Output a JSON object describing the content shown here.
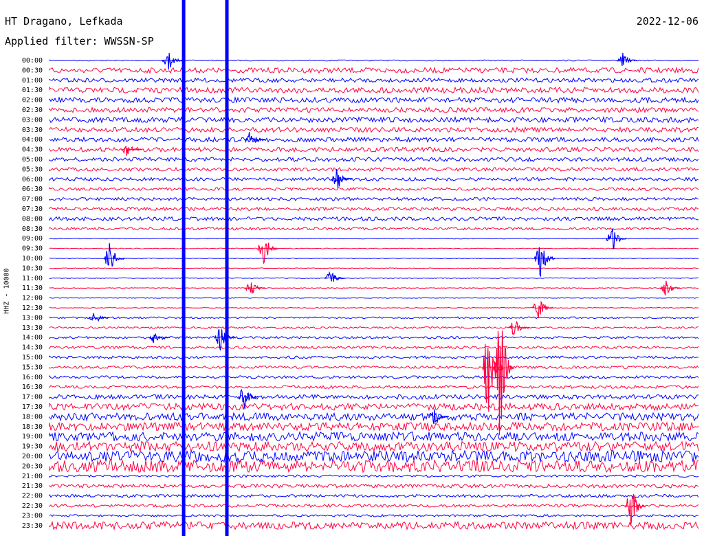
{
  "header": {
    "station": "HT Dragano, Lefkada",
    "filter": "Applied filter: WWSSN-SP",
    "date": "2022-12-06"
  },
  "y_axis_label": "HHZ - 10000",
  "chart_data": {
    "type": "line",
    "title": "HT Dragano, Lefkada",
    "subtitle": "Applied filter: WWSSN-SP",
    "date": "2022-12-06",
    "ylabel": "HHZ - 10000",
    "x_range_minutes": [
      0,
      30
    ],
    "trace_colors": [
      "#0000ff",
      "#ff0040"
    ],
    "rows": [
      {
        "label": "00:00",
        "amplitude": 0.15
      },
      {
        "label": "00:30",
        "amplitude": 0.7
      },
      {
        "label": "01:00",
        "amplitude": 0.55
      },
      {
        "label": "01:30",
        "amplitude": 0.75
      },
      {
        "label": "02:00",
        "amplitude": 0.7
      },
      {
        "label": "02:30",
        "amplitude": 0.65
      },
      {
        "label": "03:00",
        "amplitude": 0.7
      },
      {
        "label": "03:30",
        "amplitude": 0.65
      },
      {
        "label": "04:00",
        "amplitude": 0.6
      },
      {
        "label": "04:30",
        "amplitude": 0.6
      },
      {
        "label": "05:00",
        "amplitude": 0.55
      },
      {
        "label": "05:30",
        "amplitude": 0.5
      },
      {
        "label": "06:00",
        "amplitude": 0.45
      },
      {
        "label": "06:30",
        "amplitude": 0.4
      },
      {
        "label": "07:00",
        "amplitude": 0.4
      },
      {
        "label": "07:30",
        "amplitude": 0.45
      },
      {
        "label": "08:00",
        "amplitude": 0.5
      },
      {
        "label": "08:30",
        "amplitude": 0.35
      },
      {
        "label": "09:00",
        "amplitude": 0.1
      },
      {
        "label": "09:30",
        "amplitude": 0.1
      },
      {
        "label": "10:00",
        "amplitude": 0.1
      },
      {
        "label": "10:30",
        "amplitude": 0.1
      },
      {
        "label": "11:00",
        "amplitude": 0.1
      },
      {
        "label": "11:30",
        "amplitude": 0.1
      },
      {
        "label": "12:00",
        "amplitude": 0.1
      },
      {
        "label": "12:30",
        "amplitude": 0.1
      },
      {
        "label": "13:00",
        "amplitude": 0.25
      },
      {
        "label": "13:30",
        "amplitude": 0.25
      },
      {
        "label": "14:00",
        "amplitude": 0.3
      },
      {
        "label": "14:30",
        "amplitude": 0.35
      },
      {
        "label": "15:00",
        "amplitude": 0.35
      },
      {
        "label": "15:30",
        "amplitude": 0.35
      },
      {
        "label": "16:00",
        "amplitude": 0.35
      },
      {
        "label": "16:30",
        "amplitude": 0.4
      },
      {
        "label": "17:00",
        "amplitude": 0.6
      },
      {
        "label": "17:30",
        "amplitude": 0.9
      },
      {
        "label": "18:00",
        "amplitude": 1.0
      },
      {
        "label": "18:30",
        "amplitude": 1.1
      },
      {
        "label": "19:00",
        "amplitude": 1.2
      },
      {
        "label": "19:30",
        "amplitude": 1.3
      },
      {
        "label": "20:00",
        "amplitude": 1.5
      },
      {
        "label": "20:30",
        "amplitude": 1.6
      },
      {
        "label": "21:00",
        "amplitude": 0.3
      },
      {
        "label": "21:30",
        "amplitude": 0.5
      },
      {
        "label": "22:00",
        "amplitude": 0.4
      },
      {
        "label": "22:30",
        "amplitude": 0.4
      },
      {
        "label": "23:00",
        "amplitude": 0.3
      },
      {
        "label": "23:30",
        "amplitude": 1.0
      }
    ],
    "events": [
      {
        "row": "00:00",
        "minute": 5.5,
        "peak": 1.2
      },
      {
        "row": "00:00",
        "minute": 26.5,
        "peak": 0.8
      },
      {
        "row": "04:00",
        "minute": 9.3,
        "peak": 1.0
      },
      {
        "row": "04:30",
        "minute": 3.6,
        "peak": 0.8
      },
      {
        "row": "06:00",
        "minute": 13.3,
        "peak": 1.2
      },
      {
        "row": "09:00",
        "minute": 26.0,
        "peak": 1.5
      },
      {
        "row": "09:30",
        "minute": 9.9,
        "peak": 1.8
      },
      {
        "row": "10:00",
        "minute": 2.8,
        "peak": 2.0
      },
      {
        "row": "10:00",
        "minute": 22.7,
        "peak": 2.2
      },
      {
        "row": "11:00",
        "minute": 13.0,
        "peak": 0.8
      },
      {
        "row": "11:30",
        "minute": 9.3,
        "peak": 0.9
      },
      {
        "row": "11:30",
        "minute": 28.5,
        "peak": 0.9
      },
      {
        "row": "12:30",
        "minute": 22.6,
        "peak": 1.2
      },
      {
        "row": "13:00",
        "minute": 2.1,
        "peak": 0.7
      },
      {
        "row": "13:30",
        "minute": 21.5,
        "peak": 1.0
      },
      {
        "row": "14:00",
        "minute": 4.9,
        "peak": 1.1
      },
      {
        "row": "14:00",
        "minute": 7.9,
        "peak": 1.3
      },
      {
        "row": "15:30",
        "minute": 20.3,
        "peak": 6.5
      },
      {
        "row": "15:30",
        "minute": 20.8,
        "peak": 9.5
      },
      {
        "row": "17:00",
        "minute": 9.0,
        "peak": 1.5
      },
      {
        "row": "18:00",
        "minute": 17.8,
        "peak": 1.1
      },
      {
        "row": "22:30",
        "minute": 26.9,
        "peak": 2.5
      }
    ],
    "vertical_lines": [
      {
        "minute": 6.2,
        "color": "#0000ff"
      },
      {
        "minute": 8.2,
        "color": "#0000ff"
      }
    ]
  }
}
